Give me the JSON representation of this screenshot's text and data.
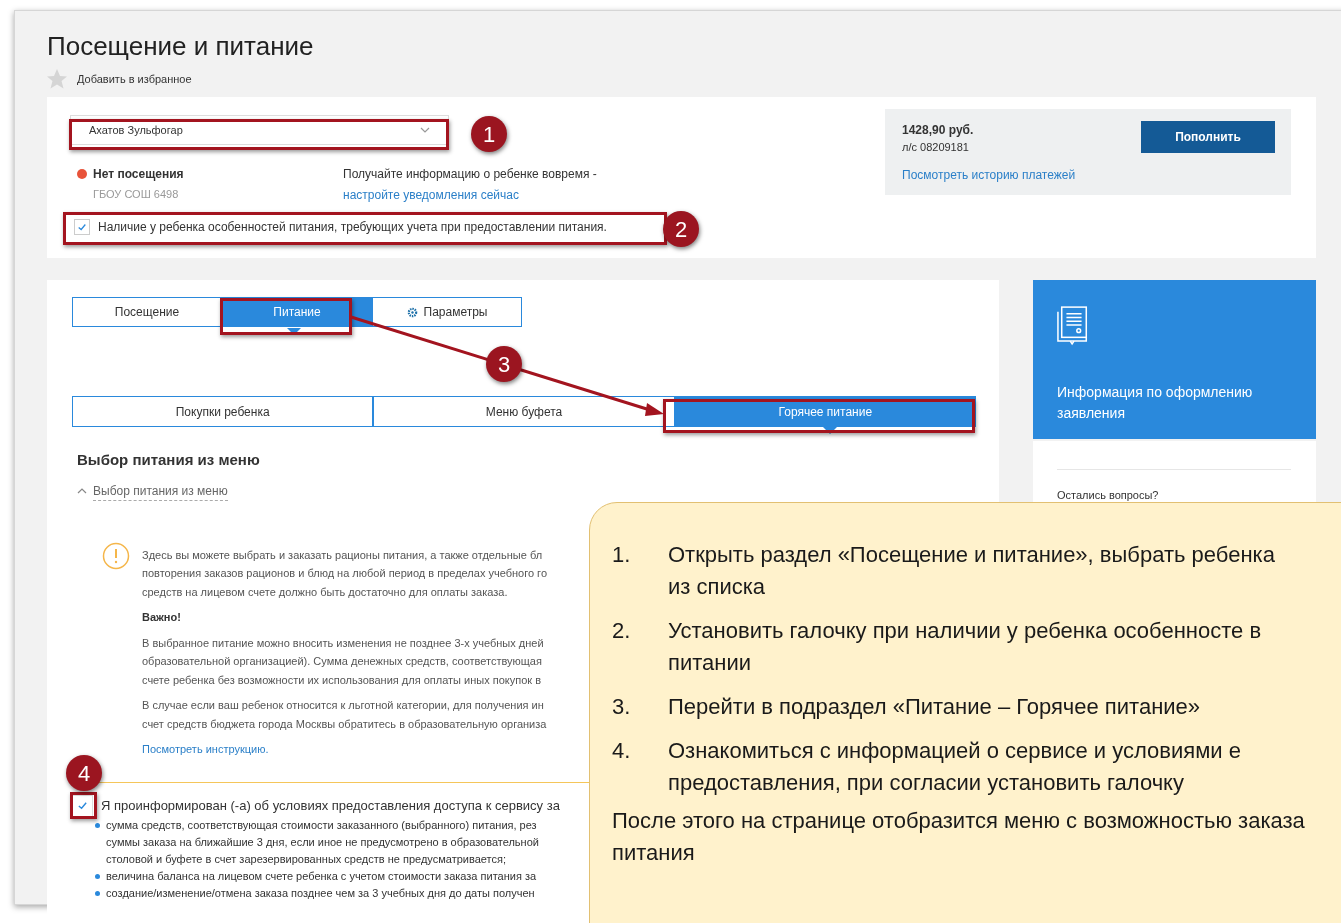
{
  "page": {
    "title": "Посещение и питание",
    "favorite_label": "Добавить в избранное"
  },
  "child_select": {
    "value": "Ахатов Зульфогар"
  },
  "attendance": {
    "status": "Нет посещения",
    "color": "#e8533a",
    "school": "ГБОУ СОШ 6498"
  },
  "notice": {
    "text": "Получайте информацию о ребенке вовремя -",
    "link": "настройте уведомления сейчас"
  },
  "diet_checkbox": {
    "label": "Наличие у ребенка особенностей питания, требующих учета при предоставлении питания.",
    "checked": true
  },
  "balance": {
    "amount": "1428,90 руб.",
    "account": "л/с 08209181",
    "history_link": "Посмотреть историю платежей",
    "button": "Пополнить"
  },
  "tabs": [
    {
      "label": "Посещение",
      "kind": "plain",
      "selected": false
    },
    {
      "label": "Питание",
      "kind": "plain",
      "selected": true
    },
    {
      "label": "Параметры",
      "kind": "gear",
      "selected": false
    }
  ],
  "subtabs": [
    {
      "label": "Покупки ребенка",
      "selected": false
    },
    {
      "label": "Меню буфета",
      "selected": false
    },
    {
      "label": "Горячее питание",
      "selected": true
    }
  ],
  "section": {
    "heading": "Выбор питания из меню",
    "toggle": "Выбор питания из меню",
    "expanded": true
  },
  "info": {
    "intro": [
      "Здесь вы можете выбрать и заказать рационы питания, а также отдельные бл",
      "повторения заказов рационов и блюд на любой период в пределах учебного го",
      "средств на лицевом счете должно быть достаточно для оплаты заказа."
    ],
    "important": "Важно!",
    "paragraphs": [
      [
        "В выбранное питание можно вносить изменения не позднее 3-х учебных дней",
        "образовательной организацией). Сумма денежных средств, соответствующая",
        "счете ребенка без возможности их использования для оплаты иных покупок в"
      ],
      [
        "В случае если ваш ребенок относится к льготной категории, для получения ин",
        "счет средств бюджета города Москвы обратитесь в образовательную организа"
      ]
    ],
    "link": "Посмотреть инструкцию."
  },
  "consent": {
    "label": "Я проинформирован (-а) об условиях предоставления доступа к сервису за",
    "checked": true,
    "bullets": [
      [
        "сумма средств, соответствующая стоимости заказанного (выбранного) питания, рез",
        "суммы заказа на ближайшие 3 дня, если иное не предусмотрено в образовательной",
        "столовой и буфете в счет зарезервированных средств не предусматривается;"
      ],
      [
        "величина баланса на лицевом счете ребенка с учетом стоимости заказа питания за"
      ],
      [
        "создание/изменение/отмена заказа позднее чем за 3 учебных дня до даты получен"
      ]
    ]
  },
  "sidebar": {
    "card_title": "Информация по оформлению заявления",
    "questions": "Остались вопросы?"
  },
  "callouts": [
    "1",
    "2",
    "3",
    "4"
  ],
  "instructions": {
    "steps": [
      {
        "number": "1.",
        "text": "Открыть раздел «Посещение и питание», выбрать ребенка из списка"
      },
      {
        "number": "2.",
        "text": "Установить галочку при наличии у ребенка особенносте в питании"
      },
      {
        "number": "3.",
        "text": "Перейти в подраздел «Питание – Горячее питание»"
      },
      {
        "number": "4.",
        "text": "Ознакомиться с информацией о сервисе и условиями е предоставления, при согласии установить галочку"
      }
    ],
    "footer": "После этого на странице отобразится меню с возможностью заказа питания"
  }
}
